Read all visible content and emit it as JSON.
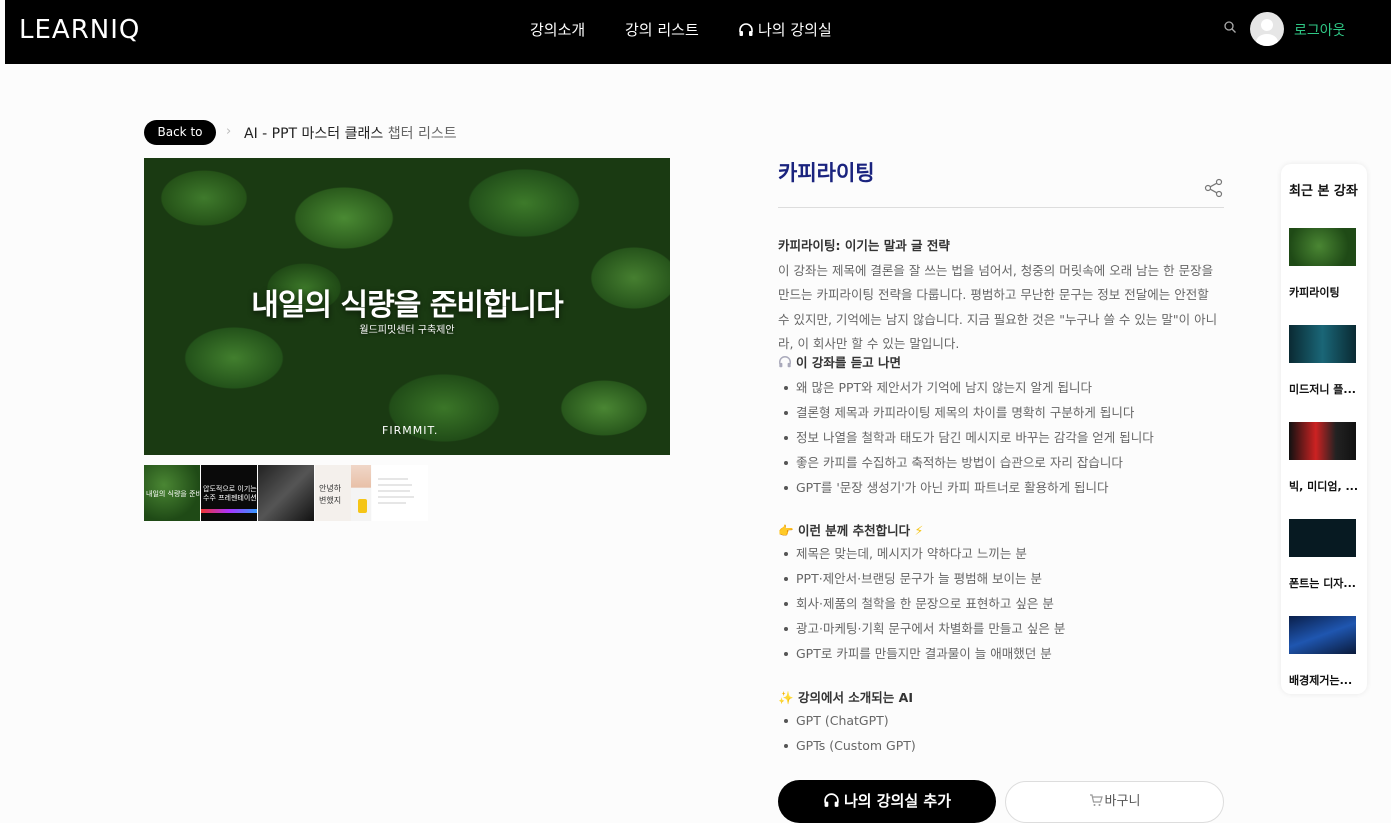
{
  "header": {
    "logo": "LEARNIQ",
    "nav": [
      "강의소개",
      "강의 리스트",
      "나의 강의실"
    ],
    "logout": "로그아웃"
  },
  "breadcrumb": {
    "back": "Back to",
    "course": "AI - PPT 마스터 클래스",
    "page": "챕터 리스트"
  },
  "hero": {
    "title": "내일의 식량을 준비합니다",
    "subtitle": "월드피밋센터 구축제안",
    "brand": "FIRMMIT."
  },
  "thumbnails": [
    {
      "text": "내일의 식량을 준비합니다"
    },
    {
      "text": "압도적으로 이기는 수주 프레젠테이션"
    },
    {
      "text": ""
    },
    {
      "text": "안녕하 변했지"
    },
    {
      "text": ""
    }
  ],
  "detail": {
    "title": "카피라이팅",
    "intro_heading": "카피라이팅: 이기는 말과 글 전략",
    "intro_body": "이 강좌는 제목에 결론을 잘 쓰는 법을 넘어서, 청중의 머릿속에 오래 남는 한 문장을 만드는 카피라이팅 전략을 다룹니다. 평범하고 무난한 문구는 정보 전달에는 안전할 수 있지만, 기억에는 남지 않습니다. 지금 필요한 것은 \"누구나 쓸 수 있는 말\"이 아니라, 이 회사만 할 수 있는 말입니다.",
    "after_heading": "이 강좌를 듣고 나면",
    "after_items": [
      "왜 많은 PPT와 제안서가 기억에 남지 않는지 알게 됩니다",
      "결론형 제목과 카피라이팅 제목의 차이를 명확히 구분하게 됩니다",
      "정보 나열을 철학과 태도가 담긴 메시지로 바꾸는 감각을 얻게 됩니다",
      "좋은 카피를 수집하고 축적하는 방법이 습관으로 자리 잡습니다",
      "GPT를 '문장 생성기'가 아닌 카피 파트너로 활용하게 됩니다"
    ],
    "recommend_heading": "이런 분께 추천합니다",
    "recommend_items": [
      "제목은 맞는데, 메시지가 약하다고 느끼는 분",
      "PPT·제안서·브랜딩 문구가 늘 평범해 보이는 분",
      "회사·제품의 철학을 한 문장으로 표현하고 싶은 분",
      "광고·마케팅·기획 문구에서 차별화를 만들고 싶은 분",
      "GPT로 카피를 만들지만 결과물이 늘 애매했던 분"
    ],
    "ai_heading": "강의에서 소개되는 AI",
    "ai_items": [
      "GPT (ChatGPT)",
      "GPTs (Custom GPT)"
    ],
    "add_button": "나의 강의실 추가",
    "cart_button": "바구니"
  },
  "recent": {
    "heading": "최근 본 강좌",
    "items": [
      "카피라이팅",
      "미드저니 플...",
      "빅, 미디엄, ...",
      "폰트는 디자...",
      "배경제거는..."
    ]
  },
  "colors": {
    "accent": "#2fc886",
    "title": "#1a237e"
  }
}
